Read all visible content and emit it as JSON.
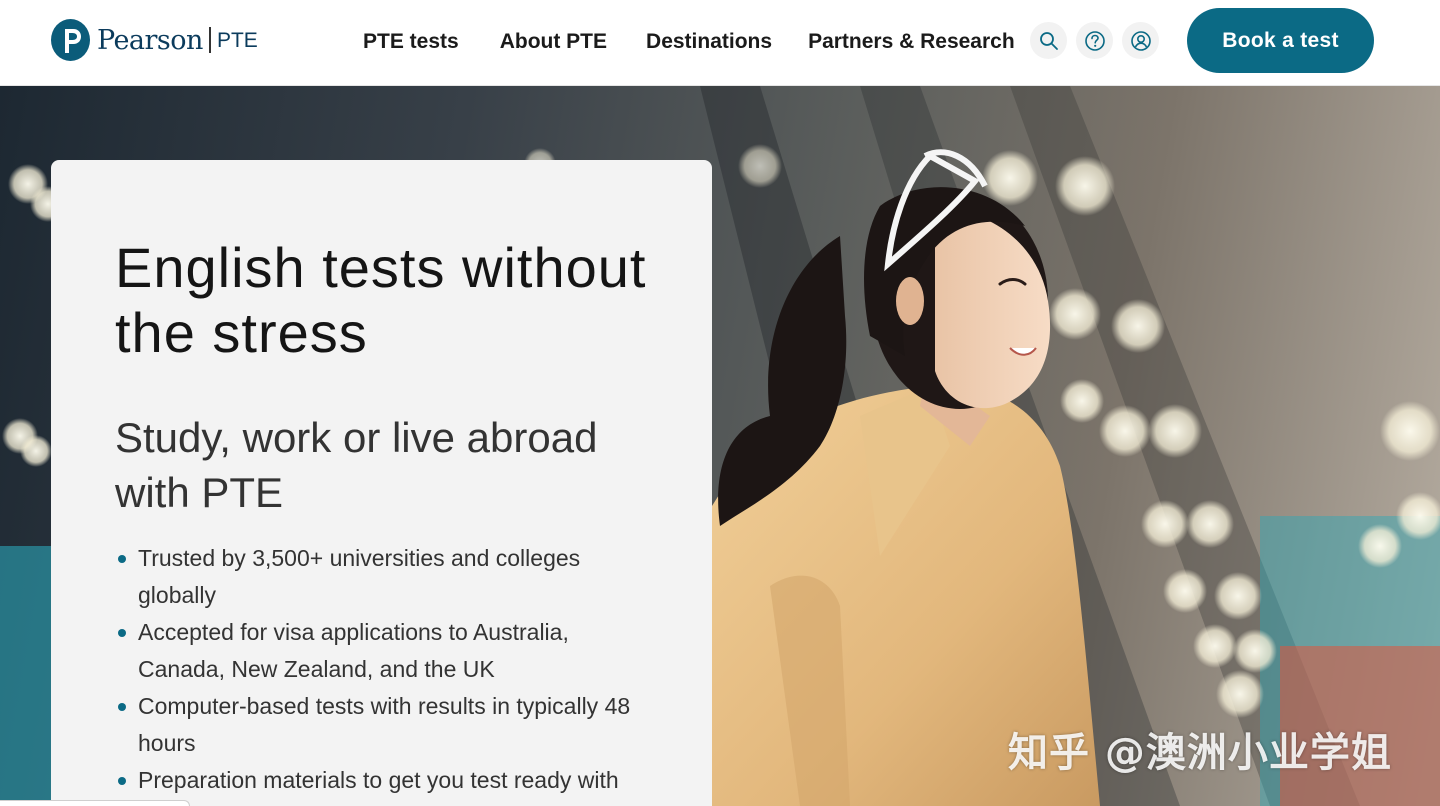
{
  "header": {
    "logo_text": "Pearson",
    "logo_sub": "PTE",
    "nav": [
      {
        "label": "PTE tests"
      },
      {
        "label": "About PTE"
      },
      {
        "label": "Destinations"
      },
      {
        "label": "Partners & Research"
      }
    ],
    "icons": [
      "search-icon",
      "help-icon",
      "account-icon"
    ],
    "book_label": "Book a test"
  },
  "hero": {
    "title": "English tests without the stress",
    "subtitle": "Study, work or live abroad with PTE",
    "bullets": [
      "Trusted by 3,500+ universities and colleges globally",
      "Accepted for visa applications to Australia, Canada, New Zealand, and the UK",
      "Computer-based tests with results in typically 48 hours",
      "Preparation materials to get you test ready with confidence"
    ]
  },
  "watermark": "知乎 @澳洲小业学姐",
  "colors": {
    "brand": "#0b6a85",
    "logo": "#0b5c7a",
    "card_bg": "#f3f3f3",
    "bullet": "#0b6a85"
  }
}
